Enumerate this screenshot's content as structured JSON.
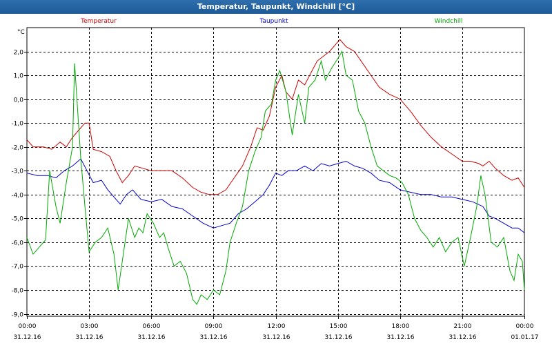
{
  "window": {
    "title": "Temperatur, Taupunkt, Windchill [°C]"
  },
  "chart_data": {
    "type": "line",
    "title": "Temperatur, Taupunkt, Windchill [°C]",
    "ylabel": "°C",
    "ylim": [
      -9.1,
      3.0
    ],
    "yticks": [
      2.0,
      1.0,
      0.0,
      -1.0,
      -2.0,
      -3.0,
      -4.0,
      -5.0,
      -6.0,
      -7.0,
      -8.0,
      -9.0
    ],
    "ytick_labels": [
      "2,0",
      "1,0",
      "0,0",
      "-1,0",
      "-2,0",
      "-3,0",
      "-4,0",
      "-5,0",
      "-6,0",
      "-7,0",
      "-8,0",
      "-9,0"
    ],
    "xlim": [
      0,
      24
    ],
    "xticks": [
      {
        "h": 0,
        "time": "00:00",
        "date": "31.12.16"
      },
      {
        "h": 3,
        "time": "03:00",
        "date": "31.12.16"
      },
      {
        "h": 6,
        "time": "06:00",
        "date": "31.12.16"
      },
      {
        "h": 9,
        "time": "09:00",
        "date": "31.12.16"
      },
      {
        "h": 12,
        "time": "12:00",
        "date": "31.12.16"
      },
      {
        "h": 15,
        "time": "15:00",
        "date": "31.12.16"
      },
      {
        "h": 18,
        "time": "18:00",
        "date": "31.12.16"
      },
      {
        "h": 21,
        "time": "21:00",
        "date": "31.12.16"
      },
      {
        "h": 24,
        "time": "00:00",
        "date": "01.01.17"
      }
    ],
    "grid": true,
    "series": [
      {
        "name": "Temperatur",
        "color": "#cc0000",
        "points": [
          [
            0,
            -1.7
          ],
          [
            0.3,
            -2.0
          ],
          [
            0.8,
            -2.0
          ],
          [
            1.2,
            -2.1
          ],
          [
            1.6,
            -1.8
          ],
          [
            1.9,
            -2.0
          ],
          [
            2.2,
            -1.6
          ],
          [
            2.5,
            -1.3
          ],
          [
            2.8,
            -1.0
          ],
          [
            3.0,
            -1.0
          ],
          [
            3.2,
            -2.1
          ],
          [
            3.6,
            -2.2
          ],
          [
            4.0,
            -2.4
          ],
          [
            4.3,
            -3.0
          ],
          [
            4.6,
            -3.5
          ],
          [
            4.9,
            -3.2
          ],
          [
            5.2,
            -2.8
          ],
          [
            5.6,
            -2.9
          ],
          [
            6.0,
            -3.0
          ],
          [
            6.5,
            -3.0
          ],
          [
            7.0,
            -3.0
          ],
          [
            7.5,
            -3.3
          ],
          [
            8.0,
            -3.7
          ],
          [
            8.4,
            -3.9
          ],
          [
            8.8,
            -4.0
          ],
          [
            9.2,
            -4.0
          ],
          [
            9.6,
            -3.8
          ],
          [
            10.0,
            -3.3
          ],
          [
            10.4,
            -2.8
          ],
          [
            10.8,
            -2.0
          ],
          [
            11.1,
            -1.2
          ],
          [
            11.4,
            -1.3
          ],
          [
            11.7,
            -0.7
          ],
          [
            12.0,
            0.5
          ],
          [
            12.3,
            1.0
          ],
          [
            12.5,
            0.3
          ],
          [
            12.8,
            0.0
          ],
          [
            13.1,
            0.8
          ],
          [
            13.4,
            0.6
          ],
          [
            13.7,
            1.1
          ],
          [
            14.0,
            1.6
          ],
          [
            14.3,
            1.8
          ],
          [
            14.6,
            2.0
          ],
          [
            14.9,
            2.3
          ],
          [
            15.1,
            2.5
          ],
          [
            15.4,
            2.2
          ],
          [
            15.8,
            2.0
          ],
          [
            16.2,
            1.5
          ],
          [
            16.6,
            1.0
          ],
          [
            17.0,
            0.5
          ],
          [
            17.5,
            0.2
          ],
          [
            18.0,
            0.0
          ],
          [
            18.5,
            -0.5
          ],
          [
            19.0,
            -1.1
          ],
          [
            19.5,
            -1.6
          ],
          [
            20.0,
            -2.0
          ],
          [
            20.5,
            -2.3
          ],
          [
            21.0,
            -2.6
          ],
          [
            21.4,
            -2.6
          ],
          [
            21.8,
            -2.7
          ],
          [
            22.0,
            -2.8
          ],
          [
            22.3,
            -2.6
          ],
          [
            22.6,
            -2.9
          ],
          [
            23.0,
            -3.2
          ],
          [
            23.4,
            -3.4
          ],
          [
            23.7,
            -3.3
          ],
          [
            24.0,
            -3.7
          ]
        ]
      },
      {
        "name": "Taupunkt",
        "color": "#0000cc",
        "points": [
          [
            0,
            -3.1
          ],
          [
            0.5,
            -3.2
          ],
          [
            1.0,
            -3.2
          ],
          [
            1.4,
            -3.3
          ],
          [
            1.8,
            -3.0
          ],
          [
            2.2,
            -2.8
          ],
          [
            2.6,
            -2.5
          ],
          [
            2.9,
            -3.0
          ],
          [
            3.2,
            -3.5
          ],
          [
            3.6,
            -3.4
          ],
          [
            3.9,
            -3.8
          ],
          [
            4.2,
            -4.1
          ],
          [
            4.5,
            -4.4
          ],
          [
            4.8,
            -4.0
          ],
          [
            5.1,
            -3.8
          ],
          [
            5.5,
            -4.2
          ],
          [
            6.0,
            -4.3
          ],
          [
            6.5,
            -4.2
          ],
          [
            7.0,
            -4.5
          ],
          [
            7.5,
            -4.6
          ],
          [
            8.0,
            -4.9
          ],
          [
            8.5,
            -5.2
          ],
          [
            9.0,
            -5.4
          ],
          [
            9.4,
            -5.3
          ],
          [
            9.8,
            -5.2
          ],
          [
            10.2,
            -4.8
          ],
          [
            10.6,
            -4.6
          ],
          [
            11.0,
            -4.3
          ],
          [
            11.4,
            -4.0
          ],
          [
            11.7,
            -3.6
          ],
          [
            12.0,
            -3.1
          ],
          [
            12.3,
            -3.2
          ],
          [
            12.6,
            -3.0
          ],
          [
            13.0,
            -3.0
          ],
          [
            13.4,
            -2.8
          ],
          [
            13.8,
            -3.0
          ],
          [
            14.2,
            -2.7
          ],
          [
            14.6,
            -2.8
          ],
          [
            15.0,
            -2.7
          ],
          [
            15.4,
            -2.6
          ],
          [
            15.8,
            -2.8
          ],
          [
            16.2,
            -2.9
          ],
          [
            16.6,
            -3.1
          ],
          [
            17.0,
            -3.4
          ],
          [
            17.5,
            -3.5
          ],
          [
            18.0,
            -3.8
          ],
          [
            18.5,
            -3.9
          ],
          [
            19.0,
            -4.0
          ],
          [
            19.5,
            -4.0
          ],
          [
            20.0,
            -4.1
          ],
          [
            20.5,
            -4.1
          ],
          [
            21.0,
            -4.2
          ],
          [
            21.5,
            -4.3
          ],
          [
            22.0,
            -4.5
          ],
          [
            22.3,
            -4.9
          ],
          [
            22.6,
            -5.0
          ],
          [
            23.0,
            -5.2
          ],
          [
            23.4,
            -5.4
          ],
          [
            23.7,
            -5.4
          ],
          [
            24.0,
            -5.6
          ]
        ]
      },
      {
        "name": "Windchill",
        "color": "#00aa00",
        "points": [
          [
            0,
            -5.8
          ],
          [
            0.3,
            -6.5
          ],
          [
            0.6,
            -6.2
          ],
          [
            0.9,
            -5.9
          ],
          [
            1.1,
            -3.0
          ],
          [
            1.4,
            -4.5
          ],
          [
            1.6,
            -5.2
          ],
          [
            1.9,
            -3.5
          ],
          [
            2.2,
            -2.0
          ],
          [
            2.3,
            1.5
          ],
          [
            2.6,
            -2.5
          ],
          [
            2.8,
            -4.5
          ],
          [
            3.0,
            -6.4
          ],
          [
            3.3,
            -6.0
          ],
          [
            3.6,
            -5.8
          ],
          [
            3.9,
            -5.4
          ],
          [
            4.2,
            -6.5
          ],
          [
            4.4,
            -8.0
          ],
          [
            4.7,
            -6.2
          ],
          [
            4.9,
            -5.0
          ],
          [
            5.2,
            -5.8
          ],
          [
            5.4,
            -5.4
          ],
          [
            5.6,
            -5.6
          ],
          [
            5.8,
            -4.8
          ],
          [
            6.1,
            -5.2
          ],
          [
            6.4,
            -5.8
          ],
          [
            6.6,
            -5.6
          ],
          [
            6.8,
            -6.2
          ],
          [
            7.1,
            -7.0
          ],
          [
            7.4,
            -6.8
          ],
          [
            7.7,
            -7.3
          ],
          [
            8.0,
            -8.4
          ],
          [
            8.2,
            -8.6
          ],
          [
            8.4,
            -8.2
          ],
          [
            8.7,
            -8.4
          ],
          [
            9.0,
            -8.0
          ],
          [
            9.3,
            -8.2
          ],
          [
            9.6,
            -7.2
          ],
          [
            9.8,
            -6.0
          ],
          [
            10.1,
            -5.2
          ],
          [
            10.4,
            -4.5
          ],
          [
            10.7,
            -3.0
          ],
          [
            11.0,
            -2.2
          ],
          [
            11.3,
            -1.6
          ],
          [
            11.5,
            -0.5
          ],
          [
            11.8,
            -0.2
          ],
          [
            12.0,
            0.8
          ],
          [
            12.2,
            1.2
          ],
          [
            12.5,
            0.3
          ],
          [
            12.8,
            -1.5
          ],
          [
            13.1,
            0.2
          ],
          [
            13.4,
            -1.0
          ],
          [
            13.6,
            0.5
          ],
          [
            13.9,
            0.8
          ],
          [
            14.2,
            1.6
          ],
          [
            14.4,
            0.8
          ],
          [
            14.7,
            1.3
          ],
          [
            15.0,
            1.7
          ],
          [
            15.2,
            2.0
          ],
          [
            15.4,
            1.0
          ],
          [
            15.7,
            0.8
          ],
          [
            16.0,
            -0.5
          ],
          [
            16.3,
            -1.0
          ],
          [
            16.6,
            -2.0
          ],
          [
            16.9,
            -2.8
          ],
          [
            17.2,
            -3.0
          ],
          [
            17.5,
            -3.2
          ],
          [
            17.8,
            -3.3
          ],
          [
            18.1,
            -3.5
          ],
          [
            18.4,
            -4.0
          ],
          [
            18.7,
            -5.0
          ],
          [
            19.0,
            -5.5
          ],
          [
            19.3,
            -5.8
          ],
          [
            19.6,
            -6.2
          ],
          [
            19.9,
            -5.8
          ],
          [
            20.2,
            -6.4
          ],
          [
            20.5,
            -6.0
          ],
          [
            20.8,
            -5.8
          ],
          [
            21.1,
            -7.0
          ],
          [
            21.4,
            -5.8
          ],
          [
            21.7,
            -4.5
          ],
          [
            21.9,
            -3.2
          ],
          [
            22.1,
            -4.0
          ],
          [
            22.4,
            -6.0
          ],
          [
            22.7,
            -6.2
          ],
          [
            23.0,
            -5.8
          ],
          [
            23.3,
            -7.2
          ],
          [
            23.5,
            -7.6
          ],
          [
            23.7,
            -6.5
          ],
          [
            23.9,
            -6.8
          ],
          [
            24.0,
            -8.0
          ]
        ]
      }
    ]
  }
}
